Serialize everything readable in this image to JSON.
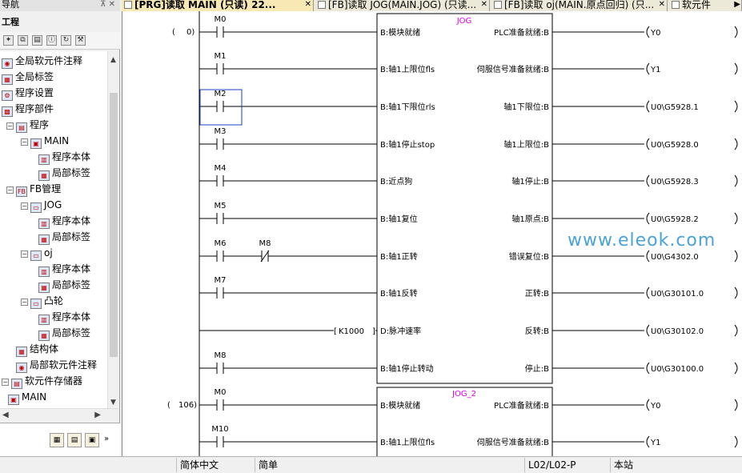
{
  "nav": {
    "title": "导航",
    "pin": "⊼ ✕",
    "subtitle": "工程",
    "toolbar_icons": [
      "new-icon",
      "copy-icon",
      "paste-icon",
      "property-icon",
      "refresh-icon",
      "tool-menu-icon"
    ],
    "tree": [
      {
        "label": "全局软元件注释",
        "icon": "comment-icon"
      },
      {
        "label": "全局标签",
        "icon": "label-icon"
      },
      {
        "label": "程序设置",
        "icon": "setting-icon"
      },
      {
        "label": "程序部件",
        "icon": "parts-icon"
      },
      {
        "label": "程序",
        "icon": "folder-icon",
        "toggle": "−"
      },
      {
        "label": "MAIN",
        "icon": "program-icon",
        "toggle": "−"
      },
      {
        "label": "程序本体",
        "icon": "program-body-icon"
      },
      {
        "label": "局部标签",
        "icon": "local-label-icon"
      },
      {
        "label": "FB管理",
        "icon": "fb-folder-icon",
        "toggle": "−"
      },
      {
        "label": "JOG",
        "icon": "fb-icon",
        "toggle": "−"
      },
      {
        "label": "程序本体",
        "icon": "program-body-icon"
      },
      {
        "label": "局部标签",
        "icon": "local-label-icon"
      },
      {
        "label": "oj",
        "icon": "fb-icon",
        "toggle": "−"
      },
      {
        "label": "程序本体",
        "icon": "program-body-icon"
      },
      {
        "label": "局部标签",
        "icon": "local-label-icon"
      },
      {
        "label": "凸轮",
        "icon": "fb-icon",
        "toggle": "−"
      },
      {
        "label": "程序本体",
        "icon": "program-body-icon"
      },
      {
        "label": "局部标签",
        "icon": "local-label-icon"
      },
      {
        "label": "结构体",
        "icon": "struct-icon"
      },
      {
        "label": "局部软元件注释",
        "icon": "comment-icon"
      },
      {
        "label": "软元件存储器",
        "icon": "memory-icon",
        "toggle": "−"
      },
      {
        "label": "MAIN",
        "icon": "memory-item-icon"
      }
    ]
  },
  "tabs": [
    {
      "label": "[PRG]读取 MAIN (只读) 22...",
      "active": true
    },
    {
      "label": "[FB]读取 JOG(MAIN.JOG) (只读..."
    },
    {
      "label": "[FB]读取 oj(MAIN.原点回归) (只..."
    },
    {
      "label": "软元件"
    }
  ],
  "ladder": {
    "step_numbers": [
      "0",
      "106"
    ],
    "fb_blocks": [
      {
        "name": "JOG",
        "inputs": [
          "B:模块就绪",
          "B:轴1上限位fls",
          "B:轴1下限位rls",
          "B:轴1停止stop",
          "B:近点狗",
          "B:轴1复位",
          "B:轴1正转",
          "B:轴1反转",
          "D:脉冲速率",
          "B:轴1停止转动"
        ],
        "outputs": [
          "PLC准备就绪:B",
          "伺服信号准备就绪:B",
          "轴1下限位:B",
          "轴1上限位:B",
          "轴1停止:B",
          "轴1原点:B",
          "错误复位:B",
          "正转:B",
          "反转:B",
          "停止:B"
        ]
      },
      {
        "name": "JOG_2",
        "inputs": [
          "B:模块就绪",
          "B:轴1上限位fls"
        ],
        "outputs": [
          "PLC准备就绪:B",
          "伺服信号准备就绪:B"
        ]
      }
    ],
    "contacts": [
      "M0",
      "M1",
      "M2",
      "M3",
      "M4",
      "M5",
      "M6",
      "M7",
      "",
      "M8"
    ],
    "series_contact": "M8",
    "constant": "K1000",
    "coils": [
      "Y0",
      "Y1",
      "U0\\G5928.1",
      "U0\\G5928.0",
      "U0\\G5928.3",
      "U0\\G5928.2",
      "U0\\G4302.0",
      "U0\\G30101.0",
      "U0\\G30102.0",
      "U0\\G30100.0"
    ],
    "block2_contacts": [
      "M0",
      "M10"
    ],
    "block2_coils": [
      "Y0",
      "Y1"
    ],
    "watermark": "www.eleok.com",
    "colors": {
      "fb_name": "#e000e0",
      "watermark": "#4aa3d8"
    }
  },
  "status": [
    "简体中文",
    "简单",
    "L02/L02-P",
    "本站"
  ]
}
